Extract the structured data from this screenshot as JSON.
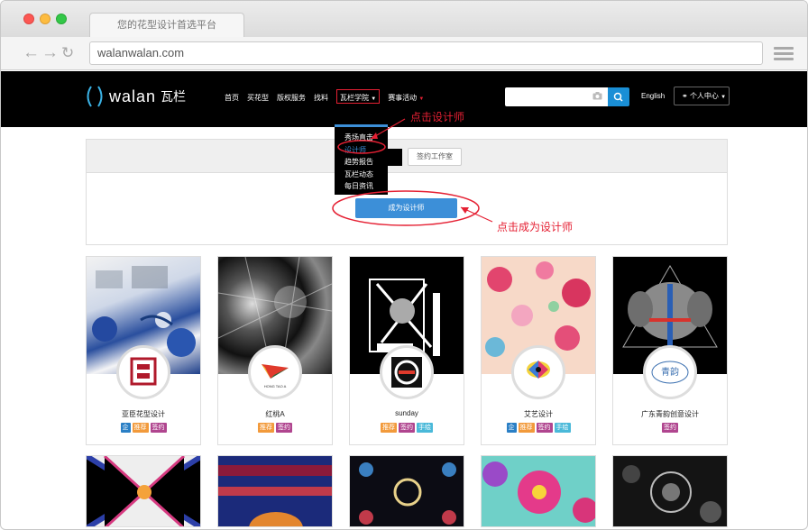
{
  "browser": {
    "tab_title": "您的花型设计首选平台",
    "url": "walanwalan.com"
  },
  "header": {
    "logo_text": "walan",
    "logo_cn": "瓦栏",
    "menu": [
      "首页",
      "买花型",
      "版权服务",
      "找料",
      "瓦栏学院",
      "赛事活动"
    ],
    "search_placeholder": "",
    "language": "English",
    "user_menu": "个人中心"
  },
  "dropdown": {
    "items": [
      "秀场直击",
      "设计师",
      "趋势报告",
      "瓦栏动态",
      "每日资讯"
    ],
    "selected": "设计师"
  },
  "panel": {
    "tab_studio": "签约工作室",
    "become_designer": "成为设计师"
  },
  "annotations": {
    "click_designer": "点击设计师",
    "click_become": "点击成为设计师"
  },
  "designers": [
    {
      "name": "亚臣花型设计",
      "badges": [
        "企",
        "推荐",
        "签约"
      ]
    },
    {
      "name": "红桃A",
      "badges": [
        "推荐",
        "签约"
      ]
    },
    {
      "name": "sunday",
      "badges": [
        "推荐",
        "签约",
        "手绘"
      ]
    },
    {
      "name": "艾艺设计",
      "badges": [
        "企",
        "推荐",
        "签约",
        "手绘"
      ]
    },
    {
      "name": "广东青韵创意设计",
      "badges": [
        "签约"
      ]
    }
  ],
  "avatar_texts": {
    "hongtao": "HONG TAO A",
    "qingyun": "青韵"
  },
  "colors": {
    "accent": "#3c8fd8",
    "annotation": "#e52033",
    "badge_qi": "#2a7fc5",
    "badge_recommend": "#f29a3b",
    "badge_signed": "#b0458f",
    "badge_hand": "#4ab9d9"
  }
}
